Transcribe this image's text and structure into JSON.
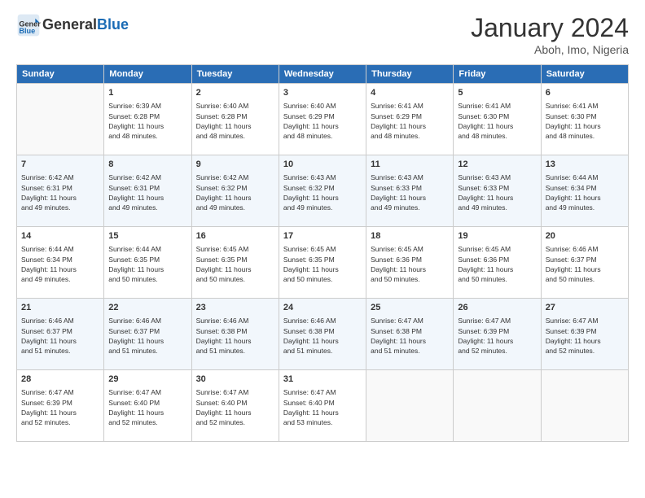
{
  "header": {
    "logo_line1": "General",
    "logo_line2": "Blue",
    "month": "January 2024",
    "location": "Aboh, Imo, Nigeria"
  },
  "days_of_week": [
    "Sunday",
    "Monday",
    "Tuesday",
    "Wednesday",
    "Thursday",
    "Friday",
    "Saturday"
  ],
  "weeks": [
    [
      {
        "day": "",
        "info": ""
      },
      {
        "day": "1",
        "info": "Sunrise: 6:39 AM\nSunset: 6:28 PM\nDaylight: 11 hours\nand 48 minutes."
      },
      {
        "day": "2",
        "info": "Sunrise: 6:40 AM\nSunset: 6:28 PM\nDaylight: 11 hours\nand 48 minutes."
      },
      {
        "day": "3",
        "info": "Sunrise: 6:40 AM\nSunset: 6:29 PM\nDaylight: 11 hours\nand 48 minutes."
      },
      {
        "day": "4",
        "info": "Sunrise: 6:41 AM\nSunset: 6:29 PM\nDaylight: 11 hours\nand 48 minutes."
      },
      {
        "day": "5",
        "info": "Sunrise: 6:41 AM\nSunset: 6:30 PM\nDaylight: 11 hours\nand 48 minutes."
      },
      {
        "day": "6",
        "info": "Sunrise: 6:41 AM\nSunset: 6:30 PM\nDaylight: 11 hours\nand 48 minutes."
      }
    ],
    [
      {
        "day": "7",
        "info": "Sunrise: 6:42 AM\nSunset: 6:31 PM\nDaylight: 11 hours\nand 49 minutes."
      },
      {
        "day": "8",
        "info": "Sunrise: 6:42 AM\nSunset: 6:31 PM\nDaylight: 11 hours\nand 49 minutes."
      },
      {
        "day": "9",
        "info": "Sunrise: 6:42 AM\nSunset: 6:32 PM\nDaylight: 11 hours\nand 49 minutes."
      },
      {
        "day": "10",
        "info": "Sunrise: 6:43 AM\nSunset: 6:32 PM\nDaylight: 11 hours\nand 49 minutes."
      },
      {
        "day": "11",
        "info": "Sunrise: 6:43 AM\nSunset: 6:33 PM\nDaylight: 11 hours\nand 49 minutes."
      },
      {
        "day": "12",
        "info": "Sunrise: 6:43 AM\nSunset: 6:33 PM\nDaylight: 11 hours\nand 49 minutes."
      },
      {
        "day": "13",
        "info": "Sunrise: 6:44 AM\nSunset: 6:34 PM\nDaylight: 11 hours\nand 49 minutes."
      }
    ],
    [
      {
        "day": "14",
        "info": "Sunrise: 6:44 AM\nSunset: 6:34 PM\nDaylight: 11 hours\nand 49 minutes."
      },
      {
        "day": "15",
        "info": "Sunrise: 6:44 AM\nSunset: 6:35 PM\nDaylight: 11 hours\nand 50 minutes."
      },
      {
        "day": "16",
        "info": "Sunrise: 6:45 AM\nSunset: 6:35 PM\nDaylight: 11 hours\nand 50 minutes."
      },
      {
        "day": "17",
        "info": "Sunrise: 6:45 AM\nSunset: 6:35 PM\nDaylight: 11 hours\nand 50 minutes."
      },
      {
        "day": "18",
        "info": "Sunrise: 6:45 AM\nSunset: 6:36 PM\nDaylight: 11 hours\nand 50 minutes."
      },
      {
        "day": "19",
        "info": "Sunrise: 6:45 AM\nSunset: 6:36 PM\nDaylight: 11 hours\nand 50 minutes."
      },
      {
        "day": "20",
        "info": "Sunrise: 6:46 AM\nSunset: 6:37 PM\nDaylight: 11 hours\nand 50 minutes."
      }
    ],
    [
      {
        "day": "21",
        "info": "Sunrise: 6:46 AM\nSunset: 6:37 PM\nDaylight: 11 hours\nand 51 minutes."
      },
      {
        "day": "22",
        "info": "Sunrise: 6:46 AM\nSunset: 6:37 PM\nDaylight: 11 hours\nand 51 minutes."
      },
      {
        "day": "23",
        "info": "Sunrise: 6:46 AM\nSunset: 6:38 PM\nDaylight: 11 hours\nand 51 minutes."
      },
      {
        "day": "24",
        "info": "Sunrise: 6:46 AM\nSunset: 6:38 PM\nDaylight: 11 hours\nand 51 minutes."
      },
      {
        "day": "25",
        "info": "Sunrise: 6:47 AM\nSunset: 6:38 PM\nDaylight: 11 hours\nand 51 minutes."
      },
      {
        "day": "26",
        "info": "Sunrise: 6:47 AM\nSunset: 6:39 PM\nDaylight: 11 hours\nand 52 minutes."
      },
      {
        "day": "27",
        "info": "Sunrise: 6:47 AM\nSunset: 6:39 PM\nDaylight: 11 hours\nand 52 minutes."
      }
    ],
    [
      {
        "day": "28",
        "info": "Sunrise: 6:47 AM\nSunset: 6:39 PM\nDaylight: 11 hours\nand 52 minutes."
      },
      {
        "day": "29",
        "info": "Sunrise: 6:47 AM\nSunset: 6:40 PM\nDaylight: 11 hours\nand 52 minutes."
      },
      {
        "day": "30",
        "info": "Sunrise: 6:47 AM\nSunset: 6:40 PM\nDaylight: 11 hours\nand 52 minutes."
      },
      {
        "day": "31",
        "info": "Sunrise: 6:47 AM\nSunset: 6:40 PM\nDaylight: 11 hours\nand 53 minutes."
      },
      {
        "day": "",
        "info": ""
      },
      {
        "day": "",
        "info": ""
      },
      {
        "day": "",
        "info": ""
      }
    ]
  ]
}
